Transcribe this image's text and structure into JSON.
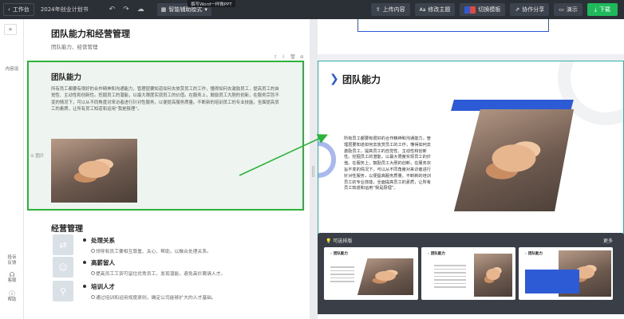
{
  "topbar": {
    "back_label": "工作台",
    "doc_title": "2024年创业计划书",
    "undo_icon": "undo-icon",
    "redo_icon": "redo-icon",
    "cloud_icon": "cloud-icon",
    "mode_label": "智能辅助模式",
    "tooltip": "撰写Word一样做PPT",
    "buttons": {
      "upload": "上传内容",
      "theme": "修改主题",
      "template": "切换模板",
      "share": "协作分享",
      "present": "演示",
      "download": "下载"
    }
  },
  "rail": {
    "collapse": "»",
    "content_settings": "内容设",
    "feedback_1": "投诉",
    "feedback_2": "反馈",
    "service": "客服",
    "help": "帮助"
  },
  "editor": {
    "section_title": "团队能力和经营管理",
    "section_subtitle": "团队能力、经营管理",
    "block_title": "团队能力",
    "block_text": "所有员工都要有很好的合作精神和沟通能力，管理层要知道如何去放赏员工的工作，懂得如何去激励员工，提高员工的自觉性、主动性和创新性。挖掘员工的潜能，以最大限度实现员工的价值。在服务上，鼓励员工大胆的创新，在服务宗旨不变的情况下，可以从不同角度对来访者进行针对性服务，以便提高服务质量。不断新的培训员工的专业技能，全面提高员工的素质，让所有员工知道和运用“我是厨理”。",
    "image_label": "图片",
    "mgmt_title": "经营管理",
    "mgmt_items": [
      {
        "title": "处理关系",
        "desc": "领导和员工要相互尊重、关心、帮助，以融合处理关系。"
      },
      {
        "title": "高薪留人",
        "desc": "提高员工工资可留住优秀员工，发现潜能，避免高价聘请人才。"
      },
      {
        "title": "培训人才",
        "desc": "通过培训和运用规度原则，确定公司能够扩大的人才基础。"
      }
    ]
  },
  "preview": {
    "slide_title": "团队能力",
    "slide_text": "所有员工都要有很好的合作精神和沟通能力，管理层要知道如何去放赏员工的工作，懂得如何去激励员工，提高员工的自觉性、主动性和创新性。挖掘员工的潜能，以最大限度实现员工的价值。在服务上，鼓励员工大胆的创新，在服务宗旨不变的情况下，可以从不同角度对来访者进行针对性服务，以便提高服务质量。不断新的培训员工的专业技能，全面提高员工的素质，让所有员工知道和运用“我是厨理”。",
    "recommend_label": "可选排版",
    "more_label": "更多",
    "cards": [
      {
        "title": "团队能力"
      },
      {
        "title": "团队能力"
      },
      {
        "title": "团队能力"
      }
    ]
  },
  "colors": {
    "accent_green": "#2db33a",
    "brand_blue": "#2d5bd6",
    "download_green": "#1fb85a",
    "topbar_bg": "#2b2f36"
  }
}
